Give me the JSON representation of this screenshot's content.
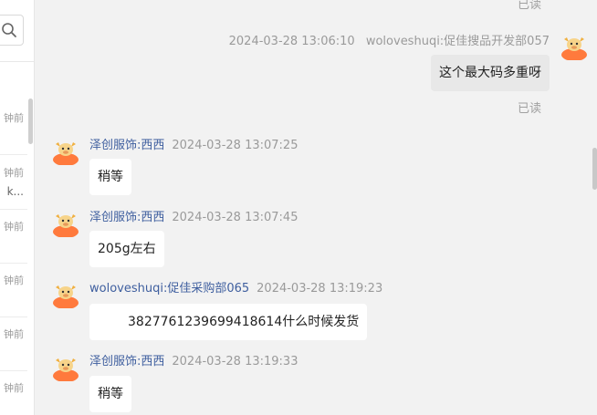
{
  "sidebar": {
    "items": [
      {
        "time": "钟前",
        "preview": ""
      },
      {
        "time": "钟前",
        "preview": "k..."
      },
      {
        "time": "钟前",
        "preview": ""
      },
      {
        "time": "钟前",
        "preview": ""
      },
      {
        "time": "钟前",
        "preview": ""
      },
      {
        "time": "钟前",
        "preview": ""
      }
    ]
  },
  "chat": {
    "top_read_status": "已读",
    "messages": [
      {
        "direction": "out",
        "sender": "woloveshuqi:促佳搜品开发部057",
        "time": "2024-03-28 13:06:10",
        "text": "这个最大码多重呀",
        "status": "已读"
      },
      {
        "direction": "in",
        "sender": "泽创服饰:西西",
        "time": "2024-03-28 13:07:25",
        "text": "稍等"
      },
      {
        "direction": "in",
        "sender": "泽创服饰:西西",
        "time": "2024-03-28 13:07:45",
        "text": "205g左右"
      },
      {
        "direction": "in",
        "sender": "woloveshuqi:促佳采购部065",
        "time": "2024-03-28 13:19:23",
        "text": "3827761239699418614什么时候发货"
      },
      {
        "direction": "in",
        "sender": "泽创服饰:西西",
        "time": "2024-03-28 13:19:33",
        "text": "稍等"
      }
    ]
  },
  "colors": {
    "sender_name": "#3f5f9f",
    "avatar_orange": "#ff7a3d",
    "avatar_face": "#f7d48a"
  }
}
